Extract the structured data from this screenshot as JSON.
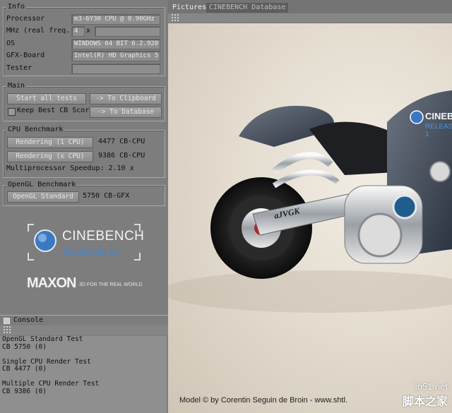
{
  "info": {
    "title": "Info",
    "processor_label": "Processor",
    "processor_value": "m3-6Y30 CPU @ 0.90GHz",
    "mhz_label": "MHz (real freq.)",
    "mhz_value": "4",
    "mhz_x": "x",
    "os_label": "OS",
    "os_value": "WINDOWS 64 BIT 6.2.920",
    "gfx_label": "GFX-Board",
    "gfx_value": "Intel(R) HD Graphics 5",
    "tester_label": "Tester",
    "tester_value": ""
  },
  "main": {
    "title": "Main",
    "start_all": "Start all tests",
    "to_clipboard": "-> To Clipboard",
    "keep_best": "Keep Best CB Score",
    "to_database": "-> To Database"
  },
  "cpu": {
    "title": "CPU Benchmark",
    "render1_label": "Rendering (1 CPU)",
    "render1_value": "4477 CB-CPU",
    "renderx_label": "Rendering (x CPU)",
    "renderx_value": "9386 CB-CPU",
    "speedup": "Multiprocessor Speedup: 2.10 x"
  },
  "opengl": {
    "title": "OpenGL Benchmark",
    "standard_label": "OpenGL Standard",
    "standard_value": "5750 CB-GFX"
  },
  "logo": {
    "cinebench": "CINEBENCH",
    "release": "RELEASE 10",
    "maxon": "MAXON",
    "tagline": "3D FOR THE REAL WORLD"
  },
  "console": {
    "title": "Console",
    "lines": [
      "OpenGL Standard Test",
      "CB 5750 (0)",
      "",
      "Single CPU Render Test",
      "CB 4477 (0)",
      "",
      "Multiple CPU Render Test",
      "CB 9386 (0)"
    ]
  },
  "tabs": {
    "pictures": "Pictures",
    "database": "CINEBENCH Database"
  },
  "render": {
    "credit": "Model © by Corentin Seguin de Broin - www.shtl.",
    "bike_cinebench": "CINEBENCH",
    "bike_release": "RELEASE 1",
    "bike_decal": "aJVGK"
  },
  "watermark": {
    "line1": "jb51.net",
    "line2": "脚本之家"
  },
  "colors": {
    "panel_bg": "#7d7d7d",
    "button_text": "#e4e4e4",
    "cinebench_blue": "#2f6fb5"
  }
}
